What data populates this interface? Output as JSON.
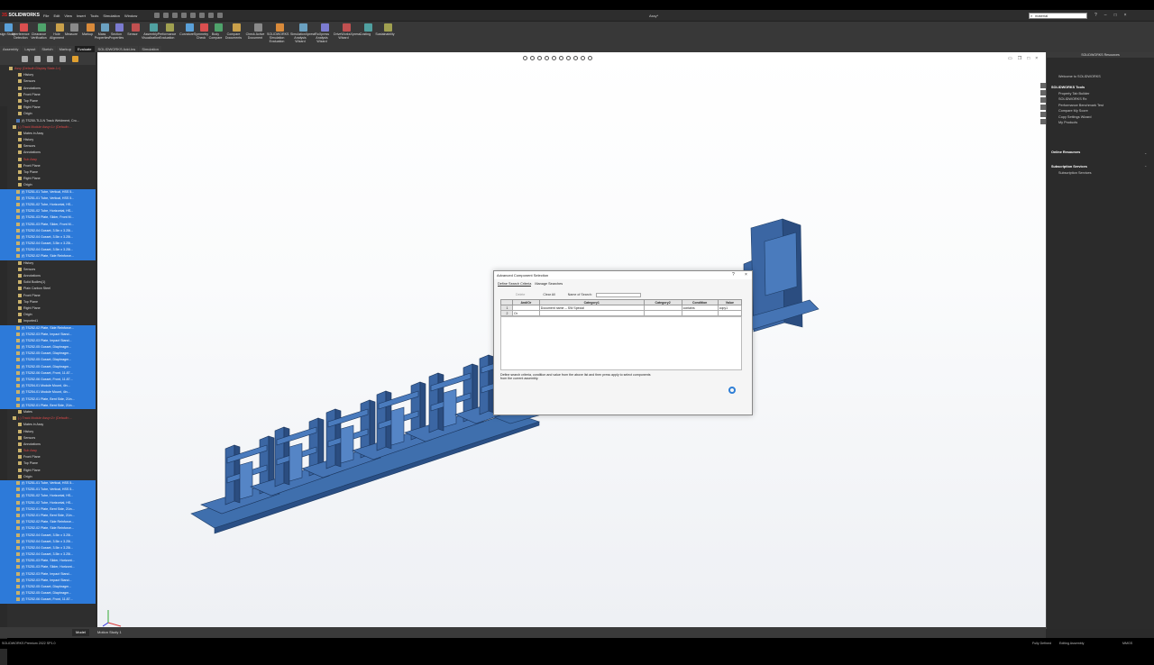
{
  "app": {
    "name": "SOLIDWORKS",
    "document_title": "Assy*"
  },
  "menu": [
    "File",
    "Edit",
    "View",
    "Insert",
    "Tools",
    "Simulation",
    "Window"
  ],
  "search": {
    "value": "material"
  },
  "ribbon": [
    "Design Study",
    "Interference Detection",
    "Clearance Verification",
    "Hole Alignment",
    "Measure",
    "Markup",
    "Mass Properties",
    "Section Properties",
    "Sensor",
    "Assembly Visualization",
    "Performance Evaluation",
    "Curvature",
    "Symmetry Check",
    "Body Compare",
    "Compare Documents",
    "Check Active Document",
    "SOLIDWORKS Simulation Evaluation",
    "SimulationXpress Analysis Wizard",
    "FloXpress Analysis Wizard",
    "DriveWorksXpress Wizard",
    "Costing",
    "Sustainability"
  ],
  "command_tabs": [
    "Assembly",
    "Layout",
    "Sketch",
    "Markup",
    "Evaluate",
    "SOLIDWORKS Add-Ins",
    "Simulation"
  ],
  "tree": [
    {
      "t": "Assy (Default<Display State-1>)",
      "k": "red"
    },
    {
      "t": "History",
      "k": ""
    },
    {
      "t": "Sensors",
      "k": ""
    },
    {
      "t": "Annotations",
      "k": ""
    },
    {
      "t": "Front Plane",
      "k": ""
    },
    {
      "t": "Top Plane",
      "k": ""
    },
    {
      "t": "Right Plane",
      "k": ""
    },
    {
      "t": "Origin",
      "k": ""
    },
    {
      "t": "(f) TS250-TL3-N Track Weldment, Cro...",
      "k": "bl"
    },
    {
      "t": "(-) Track Module Assy<1> (Default<...",
      "k": "red"
    },
    {
      "t": "Mates in Assy",
      "k": ""
    },
    {
      "t": "History",
      "k": ""
    },
    {
      "t": "Sensors",
      "k": ""
    },
    {
      "t": "Annotations",
      "k": ""
    },
    {
      "t": "Sub Assy",
      "k": "red"
    },
    {
      "t": "Front Plane",
      "k": ""
    },
    {
      "t": "Top Plane",
      "k": ""
    },
    {
      "t": "Right Plane",
      "k": ""
    },
    {
      "t": "Origin",
      "k": ""
    },
    {
      "t": "(f) TS251-01 Tube, Vertical, HSS 5...",
      "k": "sel"
    },
    {
      "t": "(f) TS251-01 Tube, Vertical, HSS 5...",
      "k": "sel"
    },
    {
      "t": "(f) TS251-02 Tube, Horizontal, HS...",
      "k": "sel"
    },
    {
      "t": "(f) TS251-02 Tube, Horizontal, HS...",
      "k": "sel"
    },
    {
      "t": "(f) TS251-03 Plate, Slider, Front M...",
      "k": "sel"
    },
    {
      "t": "(f) TS251-03 Plate, Slider, Front M...",
      "k": "sel"
    },
    {
      "t": "(f) TS252-04 Gusset, 3.5in x 3.25i...",
      "k": "sel"
    },
    {
      "t": "(f) TS252-04 Gusset, 3.5in x 3.25i...",
      "k": "sel"
    },
    {
      "t": "(f) TS252-04 Gusset, 3.5in x 3.25i...",
      "k": "sel"
    },
    {
      "t": "(f) TS252-04 Gusset, 3.5in x 3.25i...",
      "k": "sel"
    },
    {
      "t": "(f) TS252-02 Plate, Side Reinforce...",
      "k": "sel"
    },
    {
      "t": "History",
      "k": ""
    },
    {
      "t": "Sensors",
      "k": ""
    },
    {
      "t": "Annotations",
      "k": ""
    },
    {
      "t": "Solid Bodies(1)",
      "k": ""
    },
    {
      "t": "Plain Carbon Steel",
      "k": ""
    },
    {
      "t": "Front Plane",
      "k": ""
    },
    {
      "t": "Top Plane",
      "k": ""
    },
    {
      "t": "Right Plane",
      "k": ""
    },
    {
      "t": "Origin",
      "k": ""
    },
    {
      "t": "Imported1",
      "k": ""
    },
    {
      "t": "(f) TS252-02 Plate, Side Reinforce...",
      "k": "sel"
    },
    {
      "t": "(f) TS252-03 Plate, Impact Stand...",
      "k": "sel"
    },
    {
      "t": "(f) TS252-03 Plate, Impact Stand...",
      "k": "sel"
    },
    {
      "t": "(f) TS252-05 Gusset, Diaphragm...",
      "k": "sel"
    },
    {
      "t": "(f) TS252-05 Gusset, Diaphragm...",
      "k": "sel"
    },
    {
      "t": "(f) TS252-05 Gusset, Diaphragm...",
      "k": "sel"
    },
    {
      "t": "(f) TS252-05 Gusset, Diaphragm...",
      "k": "sel"
    },
    {
      "t": "(f) TS252-06 Gusset, Front, 11.87...",
      "k": "sel"
    },
    {
      "t": "(f) TS252-06 Gusset, Front, 11.87...",
      "k": "sel"
    },
    {
      "t": "(f) TS254-01 Module Mount, 4in...",
      "k": "sel"
    },
    {
      "t": "(f) TS254-01 Module Mount, 4in...",
      "k": "sel"
    },
    {
      "t": "(f) TS252-01 Plate, Bent Side, 21in...",
      "k": "sel"
    },
    {
      "t": "(f) TS252-01 Plate, Bent Side, 21in...",
      "k": "sel"
    },
    {
      "t": "Mates",
      "k": ""
    },
    {
      "t": "(-) Track Module Assy<2> (Default<...",
      "k": "red"
    },
    {
      "t": "Mates in Assy",
      "k": ""
    },
    {
      "t": "History",
      "k": ""
    },
    {
      "t": "Sensors",
      "k": ""
    },
    {
      "t": "Annotations",
      "k": ""
    },
    {
      "t": "Sub Assy",
      "k": "red"
    },
    {
      "t": "Front Plane",
      "k": ""
    },
    {
      "t": "Top Plane",
      "k": ""
    },
    {
      "t": "Right Plane",
      "k": ""
    },
    {
      "t": "Origin",
      "k": ""
    },
    {
      "t": "(f) TS251-01 Tube, Vertical, HSS 5...",
      "k": "sel"
    },
    {
      "t": "(f) TS251-01 Tube, Vertical, HSS 5...",
      "k": "sel"
    },
    {
      "t": "(f) TS251-02 Tube, Horizontal, HS...",
      "k": "sel"
    },
    {
      "t": "(f) TS251-02 Tube, Horizontal, HS...",
      "k": "sel"
    },
    {
      "t": "(f) TS252-01 Plate, Bent Side, 21in...",
      "k": "sel"
    },
    {
      "t": "(f) TS252-01 Plate, Bent Side, 21in...",
      "k": "sel"
    },
    {
      "t": "(f) TS252-02 Plate, Side Reinforce...",
      "k": "sel"
    },
    {
      "t": "(f) TS252-02 Plate, Side Reinforce...",
      "k": "sel"
    },
    {
      "t": "(f) TS252-04 Gusset, 3.5in x 3.25i...",
      "k": "sel"
    },
    {
      "t": "(f) TS252-04 Gusset, 3.5in x 3.25i...",
      "k": "sel"
    },
    {
      "t": "(f) TS252-04 Gusset, 3.5in x 3.25i...",
      "k": "sel"
    },
    {
      "t": "(f) TS252-04 Gusset, 3.5in x 3.25i...",
      "k": "sel"
    },
    {
      "t": "(f) TS251-03 Plate, Slider, Horizont...",
      "k": "sel"
    },
    {
      "t": "(f) TS251-03 Plate, Slider, Horizont...",
      "k": "sel"
    },
    {
      "t": "(f) TS252-03 Plate, Impact Stand...",
      "k": "sel"
    },
    {
      "t": "(f) TS252-03 Plate, Impact Stand...",
      "k": "sel"
    },
    {
      "t": "(f) TS252-05 Gusset, Diaphragm...",
      "k": "sel"
    },
    {
      "t": "(f) TS252-05 Gusset, Diaphragm...",
      "k": "sel"
    },
    {
      "t": "(f) TS252-06 Gusset, Front, 11.87...",
      "k": "sel"
    }
  ],
  "bottom_tabs": [
    "Model",
    "Motion Study 1"
  ],
  "task_pane": {
    "title": "SOLIDWORKS Resources",
    "welcome": "Welcome to SOLIDWORKS",
    "tools_title": "SOLIDWORKS Tools",
    "tools": [
      "Property Tab Builder",
      "SOLIDWORKS Rx",
      "Performance Benchmark Test",
      "Compare My Score",
      "Copy Settings Wizard",
      "My Products"
    ],
    "online_title": "Online Resources",
    "sub_title": "Subscription Services",
    "sub_items": [
      "Subscription Services"
    ]
  },
  "dialog": {
    "title": "Advanced Component Selection",
    "help": "?",
    "close": "×",
    "tabs": [
      "Define Search Criteria",
      "Manage Searches"
    ],
    "delete": "Delete",
    "clear_all": "Clear All",
    "name_label": "Name of Search:",
    "columns": [
      "",
      "And/Or",
      "Category1",
      "Category2",
      "Condition",
      "Value"
    ],
    "rows": [
      [
        "1",
        "",
        "Document name -- SW Special",
        "",
        "contains",
        "copy1"
      ],
      [
        "2",
        "Or",
        "",
        "",
        "",
        ""
      ]
    ],
    "note": "Define search criteria, condition and value from the above list and then press apply to select components from the current assembly."
  },
  "status": {
    "left": "SOLIDWORKS Premium 2022 SP1.0",
    "fully_defined": "Fully Defined",
    "editing": "Editing Assembly",
    "units": "MMGS"
  }
}
